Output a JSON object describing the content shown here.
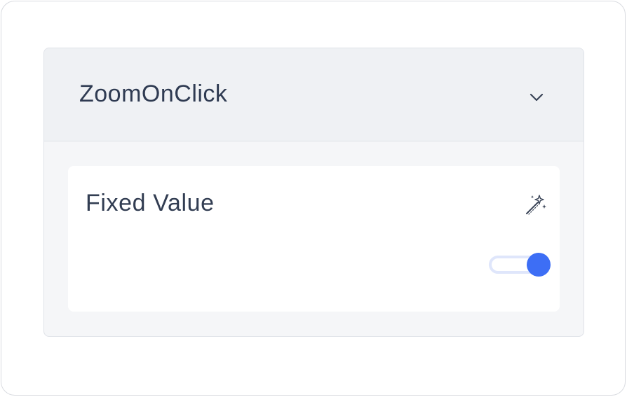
{
  "panel": {
    "title": "ZoomOnClick",
    "expand_icon": "chevron-down-icon"
  },
  "field": {
    "label": "Fixed Value",
    "dynamic_icon": "magic-wand-icon",
    "toggle_on": true
  },
  "colors": {
    "accent": "#3d6ef5",
    "text": "#2f3b52",
    "header_bg": "#eff1f4",
    "panel_bg": "#f5f6f8"
  }
}
